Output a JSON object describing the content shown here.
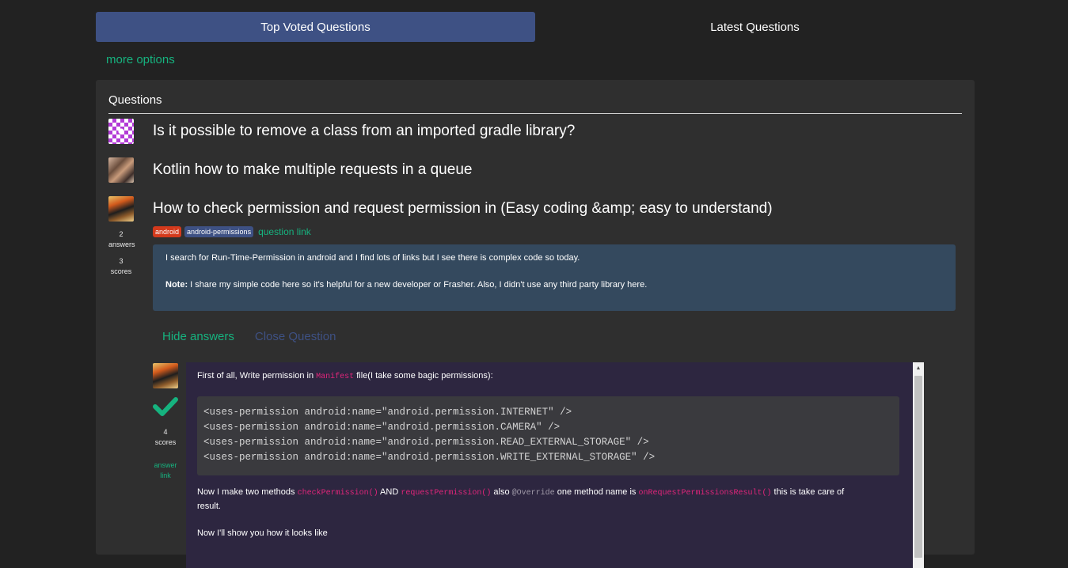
{
  "tabs": [
    {
      "label": "Top Voted Questions",
      "active": true
    },
    {
      "label": "Latest Questions",
      "active": false
    }
  ],
  "more_options": "more options",
  "panel": {
    "title": "Questions"
  },
  "questions": [
    {
      "title": "Is it possible to remove a class from an imported gradle library?",
      "avatar": "identicon-avatar"
    },
    {
      "title": "Kotlin how to make multiple requests in a queue",
      "avatar": "photo-avatar"
    },
    {
      "title": "How to check permission and request permission in (Easy coding &amp; easy to understand)",
      "avatar": "photo-avatar",
      "answers_count": "2",
      "answers_label": "answers",
      "scores_count": "3",
      "scores_label": "scores",
      "tags": [
        "android",
        "android-permissions"
      ],
      "link_label": "question link",
      "body": {
        "line1": "I search for Run-Time-Permission in android and I find lots of links but I see there is complex code so today.",
        "note_label": "Note:",
        "note_text": " I share my simple code here so it's helpful for a new developer or Frasher. Also, I didn't use any third party library here."
      }
    }
  ],
  "actions": {
    "hide_answers": "Hide answers",
    "close_question": "Close Question"
  },
  "answer": {
    "scores_count": "4",
    "scores_label": "scores",
    "link_label": "answer link",
    "intro_a": "First of all, Write permission in ",
    "intro_code": "Manifest",
    "intro_b": " file(I take some bagic permissions):",
    "code_lines": [
      "<uses-permission android:name=\"android.permission.INTERNET\" />",
      "<uses-permission android:name=\"android.permission.CAMERA\" />",
      "<uses-permission android:name=\"android.permission.READ_EXTERNAL_STORAGE\" />",
      "<uses-permission android:name=\"android.permission.WRITE_EXTERNAL_STORAGE\" />"
    ],
    "p2_a": "Now I make two methods ",
    "p2_code1": "checkPermission()",
    "p2_b": " AND ",
    "p2_code2": "requestPermission()",
    "p2_c": " also ",
    "p2_code3": "@Override",
    "p2_d": " one method name is ",
    "p2_code4": "onRequestPermissionsResult()",
    "p2_e": " this is take care of",
    "p2_f": "result.",
    "p3": "Now I'll show you how it looks like"
  },
  "colors": {
    "accent": "#3e5184",
    "green": "#16b37f",
    "background": "#222222",
    "panel": "#2f2f2f",
    "question_body": "#34495e",
    "answer_body": "#2d2640"
  }
}
